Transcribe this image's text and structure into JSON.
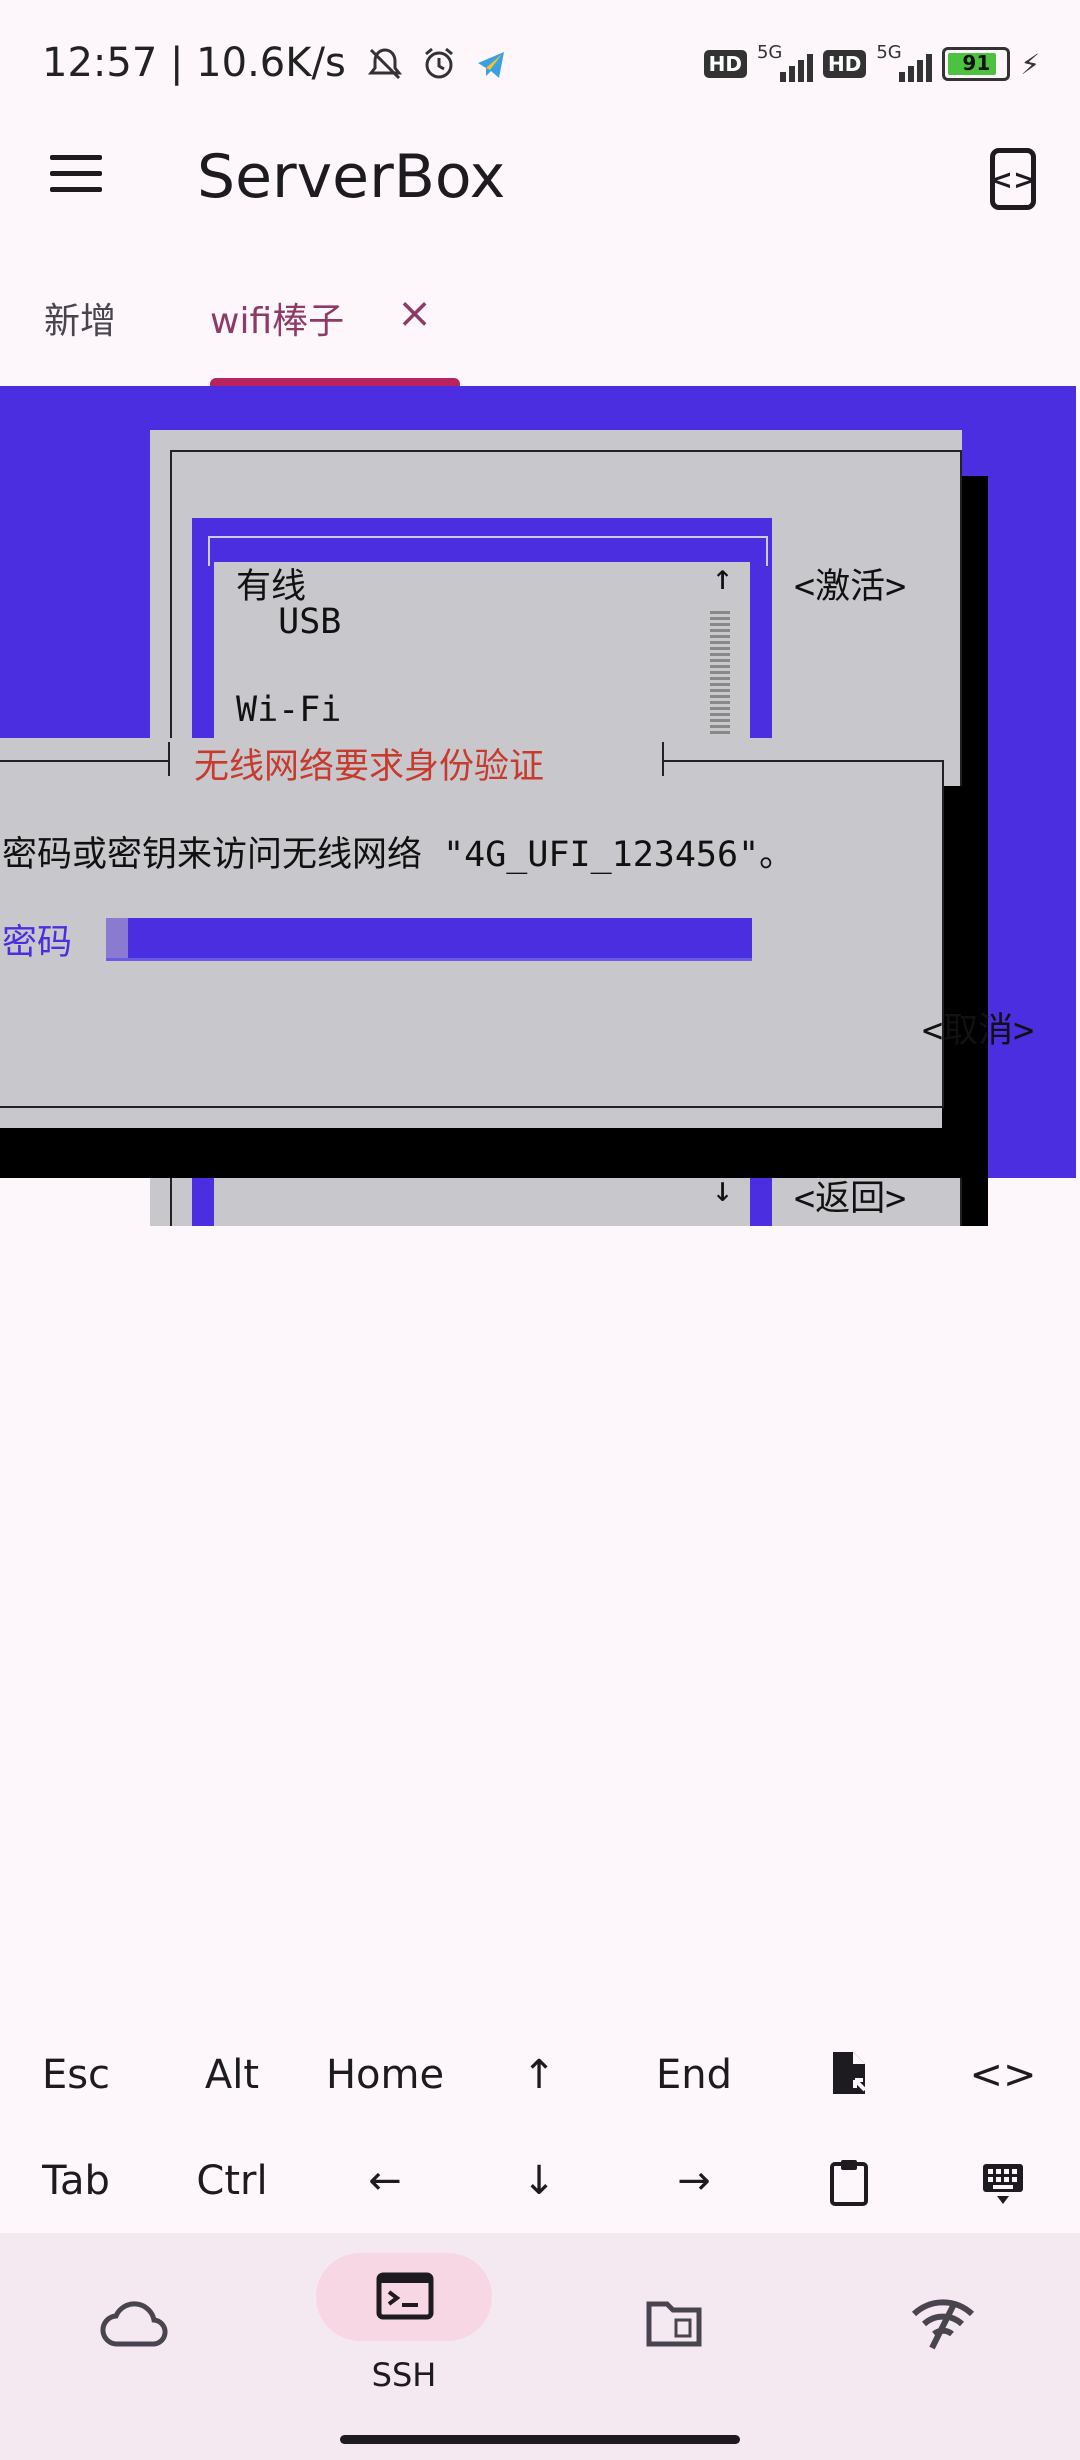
{
  "status_bar": {
    "time": "12:57 | 10.6K/s",
    "sim1_hd": "HD",
    "sim1_net": "5G",
    "sim2_hd": "HD",
    "sim2_net": "5G",
    "battery": "91"
  },
  "app_bar": {
    "title": "ServerBox"
  },
  "tabs": [
    {
      "label": "新增"
    },
    {
      "label": "wifi棒子",
      "active": true,
      "close": "×"
    }
  ],
  "terminal": {
    "list_items": [
      "有线",
      "  USB",
      "",
      "Wi-Fi"
    ],
    "button_activate": "<激活>",
    "button_back": "<返回>",
    "dialog_title": "无线网络要求身份验证",
    "dialog_message": "密码或密钥来访问无线网络 \"4G_UFI_123456\"。",
    "password_label": "密码",
    "button_cancel": "<取消>",
    "arrow_up": "↑",
    "arrow_down": "↓",
    "colors": {
      "background": "#4a2ee0",
      "panel": "#c8c8cc",
      "title": "#c63b2e"
    }
  },
  "extra_keys": {
    "row1": [
      "Esc",
      "Alt",
      "Home",
      "↑",
      "End",
      "file-icon",
      "<>"
    ],
    "row2": [
      "Tab",
      "Ctrl",
      "←",
      "↓",
      "→",
      "clipboard-icon",
      "keyboard-icon"
    ]
  },
  "bottom_nav": {
    "active_label": "SSH",
    "items": [
      "cloud-icon",
      "terminal-icon",
      "folder-icon",
      "wifi-icon"
    ]
  }
}
